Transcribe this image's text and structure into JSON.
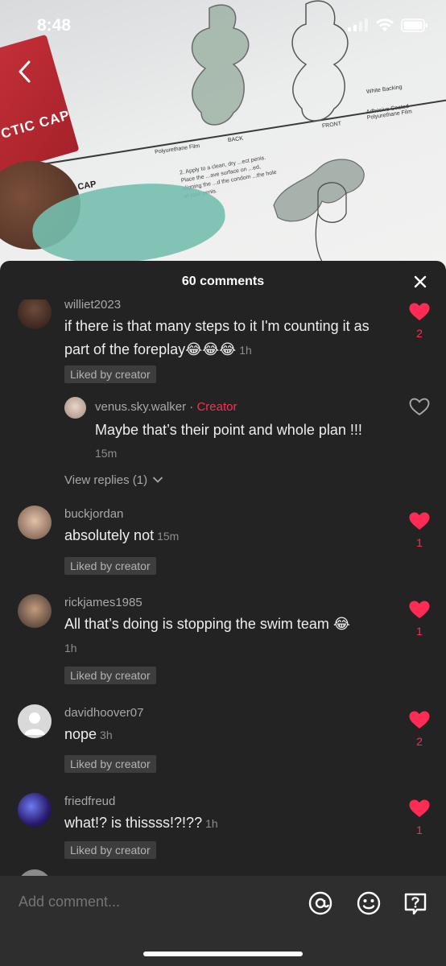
{
  "status": {
    "time": "8:48"
  },
  "video": {
    "labels": {
      "card": "CTIC CAP",
      "cap_caption": "ACTIC CAP",
      "film": "Polyurethane Film",
      "back": "BACK",
      "front": "FRONT",
      "white_backing": "White Backing",
      "adhesive": "Adhesive Coated Polyurethane Film",
      "instructions": "2. Apply to a clean, dry ...ect penis. Place the ...ave surface on ...ed, aligning the ...d the condom ...the hole of your penis."
    }
  },
  "sheet": {
    "title": "60 comments"
  },
  "comments": [
    {
      "username": "williet2023",
      "text": "if there is that many steps to it I'm counting it as part of the foreplay😂😂😂",
      "time": "1h",
      "liked_by_creator": "Liked by creator",
      "likes": "2",
      "liked": true
    },
    {
      "reply": true,
      "username": "venus.sky.walker",
      "separator": " · ",
      "creator_label": "Creator",
      "text": "Maybe that’s their point and whole plan !!!",
      "time": "15m",
      "liked": false
    },
    {
      "view_replies": "View replies (1)"
    },
    {
      "username": "buckjordan",
      "text": "absolutely not",
      "time": "15m",
      "liked_by_creator": "Liked by creator",
      "likes": "1",
      "liked": true
    },
    {
      "username": "rickjames1985",
      "text": "All that’s doing is stopping the swim team 😂",
      "time": "1h",
      "liked_by_creator": "Liked by creator",
      "likes": "1",
      "liked": true
    },
    {
      "username": "davidhoover07",
      "text": "nope",
      "time": "3h",
      "liked_by_creator": "Liked by creator",
      "likes": "2",
      "liked": true
    },
    {
      "username": "friedfreud",
      "text": "what!? is thissss!?!??",
      "time": "1h",
      "liked_by_creator": "Liked by creator",
      "likes": "1",
      "liked": true
    }
  ],
  "input": {
    "placeholder": "Add comment..."
  },
  "colors": {
    "accent": "#fe2c55",
    "sheet_bg": "#232323",
    "input_bg": "#2e2e2e"
  },
  "icons": {
    "back": "chevron-left-icon",
    "close": "close-icon",
    "mention": "at-sign-icon",
    "emoji": "smiley-icon",
    "question": "question-icon",
    "like": "heart-icon"
  }
}
